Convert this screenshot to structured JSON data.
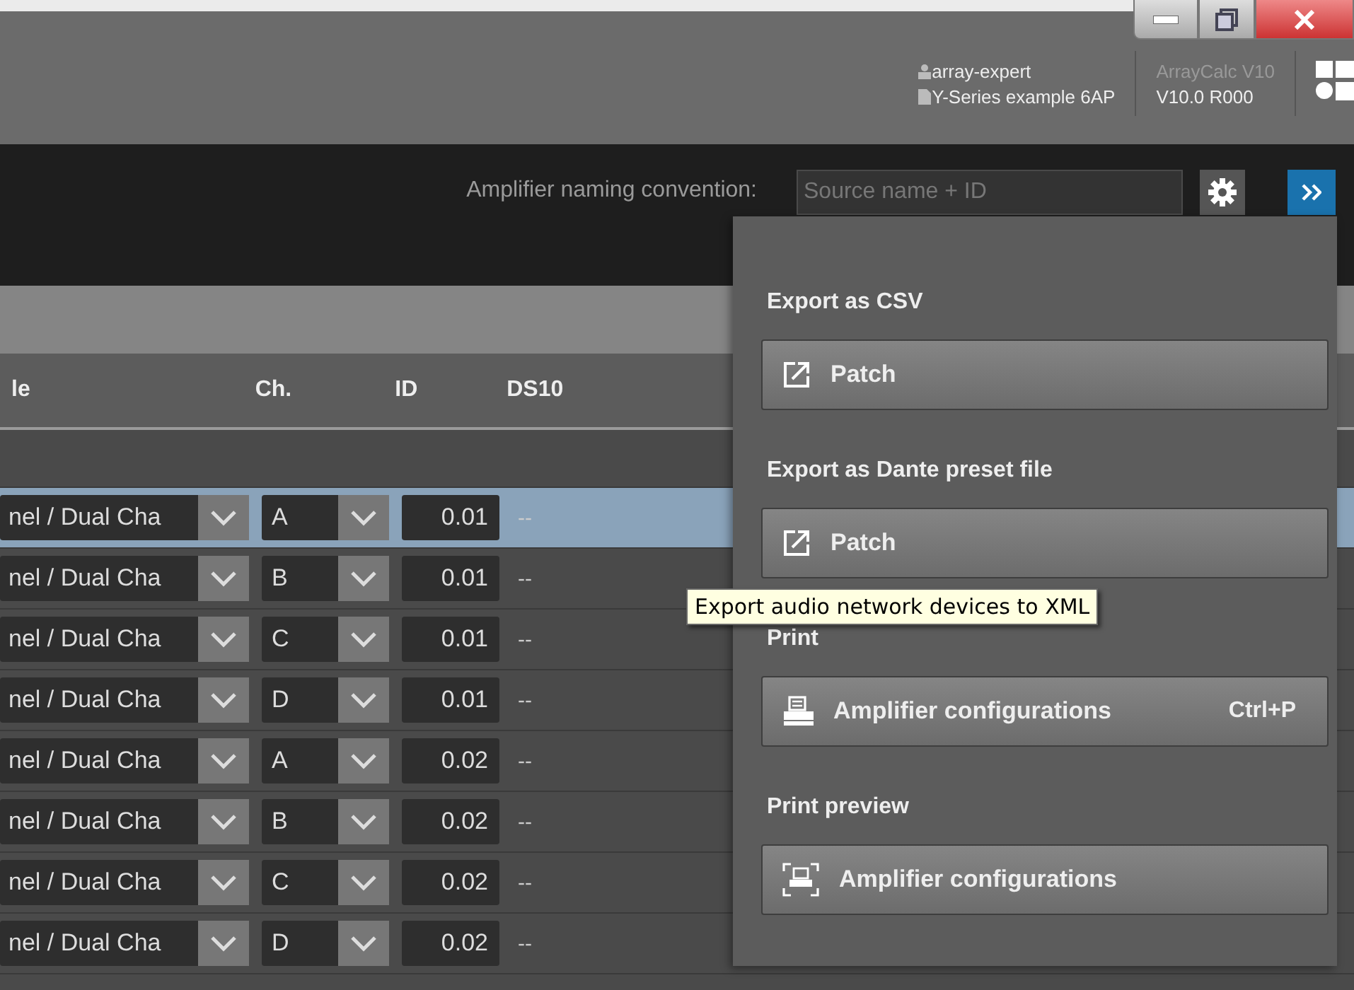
{
  "header": {
    "user": "array-expert",
    "project": "Y-Series example 6AP",
    "app_name": "ArrayCalc V10",
    "version": "V10.0 R000"
  },
  "toolbar": {
    "naming_label": "Amplifier naming convention:",
    "naming_field": {
      "placeholder": "Source name + ID"
    }
  },
  "table": {
    "columns": [
      "le",
      "Ch.",
      "ID",
      "DS10"
    ],
    "rows": [
      {
        "mode": "nel / Dual Cha",
        "channel": "A",
        "id": "0.01",
        "ds10": "--",
        "selected": true
      },
      {
        "mode": "nel / Dual Cha",
        "channel": "B",
        "id": "0.01",
        "ds10": "--",
        "selected": false
      },
      {
        "mode": "nel / Dual Cha",
        "channel": "C",
        "id": "0.01",
        "ds10": "--",
        "selected": false
      },
      {
        "mode": "nel / Dual Cha",
        "channel": "D",
        "id": "0.01",
        "ds10": "--",
        "selected": false
      },
      {
        "mode": "nel / Dual Cha",
        "channel": "A",
        "id": "0.02",
        "ds10": "--",
        "selected": false
      },
      {
        "mode": "nel / Dual Cha",
        "channel": "B",
        "id": "0.02",
        "ds10": "--",
        "selected": false
      },
      {
        "mode": "nel / Dual Cha",
        "channel": "C",
        "id": "0.02",
        "ds10": "--",
        "selected": false
      },
      {
        "mode": "nel / Dual Cha",
        "channel": "D",
        "id": "0.02",
        "ds10": "--",
        "selected": false
      }
    ]
  },
  "export_panel": {
    "sections": [
      {
        "heading": "Export as CSV",
        "button": {
          "kind": "export",
          "label": "Patch"
        }
      },
      {
        "heading": "Export as Dante preset file",
        "button": {
          "kind": "export",
          "label": "Patch"
        }
      },
      {
        "heading": "Print",
        "button": {
          "kind": "print",
          "label": "Amplifier configurations",
          "shortcut": "Ctrl+P"
        }
      },
      {
        "heading": "Print preview",
        "button": {
          "kind": "preview",
          "label": "Amplifier configurations"
        }
      }
    ]
  },
  "tooltip": "Export audio network devices to XML"
}
